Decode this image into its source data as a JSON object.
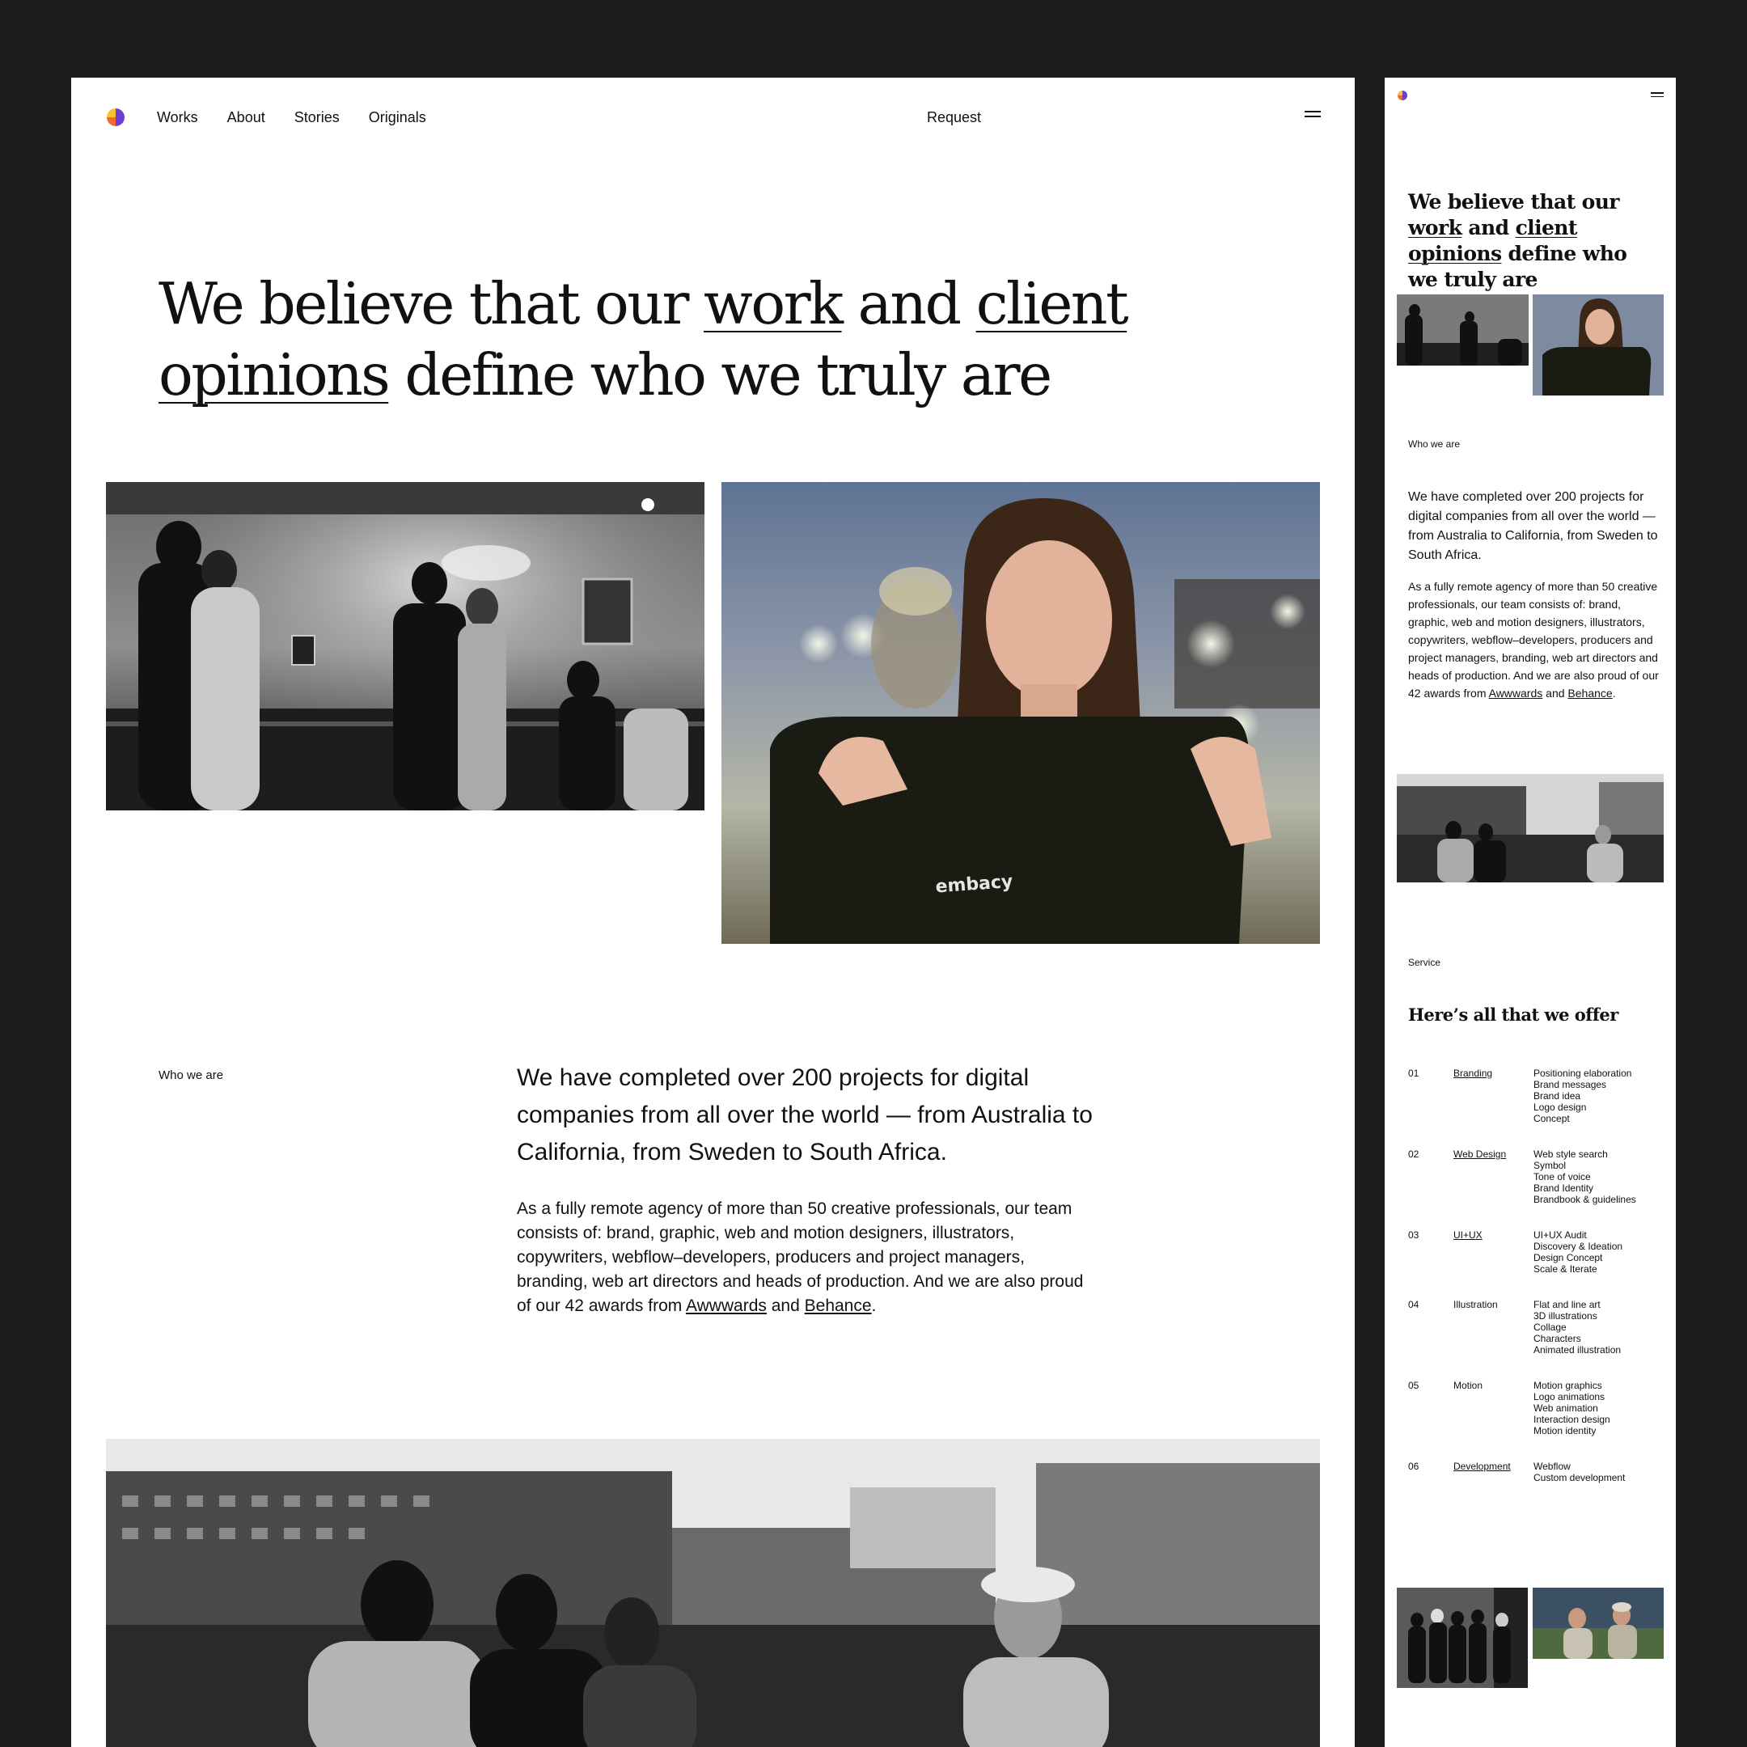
{
  "nav": {
    "items": [
      "Works",
      "About",
      "Stories",
      "Originals"
    ],
    "request": "Request"
  },
  "hero": {
    "part1": "We believe that our ",
    "link_work": "work",
    "part2": " and ",
    "link_client": "client opinions",
    "part3": " define who we truly are"
  },
  "who": {
    "label": "Who we are",
    "lead": "We have completed over 200 projects for digital companies from all over the world — from Australia to California, from Sweden to South Africa.",
    "body_before": "As a fully remote agency of more than 50 creative professionals, our team consists of: brand, graphic, web and motion designers, illustrators, copywriters, webflow–developers, producers and project managers, branding, web art directors and heads of production. And we are also proud of our 42 awards from ",
    "link_awwwards": "Awwwards",
    "and": " and ",
    "link_behance": "Behance",
    "period": "."
  },
  "photos": {
    "p1": "Black-and-white photo of people standing at a balcony railing under a chandelier",
    "p2": "Woman smiling and holding up a black embacy t-shirt",
    "p2_print": "embacy",
    "p3": "Black-and-white photo of a group sitting on a rooftop with buildings behind",
    "p4": "Black-and-white group portrait of team",
    "p5": "Two men talking outdoors at dusk"
  },
  "services": {
    "label": "Service",
    "title": "Here’s all that we offer",
    "list": [
      {
        "num": "01",
        "name": "Branding",
        "link": true,
        "items": [
          "Positioning elaboration",
          "Brand messages",
          "Brand idea",
          "Logo design",
          "Concept"
        ]
      },
      {
        "num": "02",
        "name": "Web Design",
        "link": true,
        "items": [
          "Web style search",
          "Symbol",
          "Tone of voice",
          "Brand Identity",
          "Brandbook & guidelines"
        ]
      },
      {
        "num": "03",
        "name": "UI+UX",
        "link": true,
        "items": [
          "UI+UX Audit",
          "Discovery & Ideation",
          "Design Concept",
          "Scale & Iterate"
        ]
      },
      {
        "num": "04",
        "name": "Illustration",
        "link": false,
        "items": [
          "Flat and line art",
          "3D illustrations",
          "Collage",
          "Characters",
          "Animated illustration"
        ]
      },
      {
        "num": "05",
        "name": "Motion",
        "link": false,
        "items": [
          "Motion graphics",
          "Logo animations",
          "Web animation",
          "Interaction design",
          "Motion identity"
        ]
      },
      {
        "num": "06",
        "name": "Development",
        "link": true,
        "items": [
          "Webflow",
          "Custom development"
        ]
      }
    ]
  },
  "colors": {
    "background": "#1c1c1c",
    "page": "#ffffff",
    "text": "#111111",
    "logo": [
      "#6a3fd1",
      "#f36a2d",
      "#f6c234"
    ]
  }
}
